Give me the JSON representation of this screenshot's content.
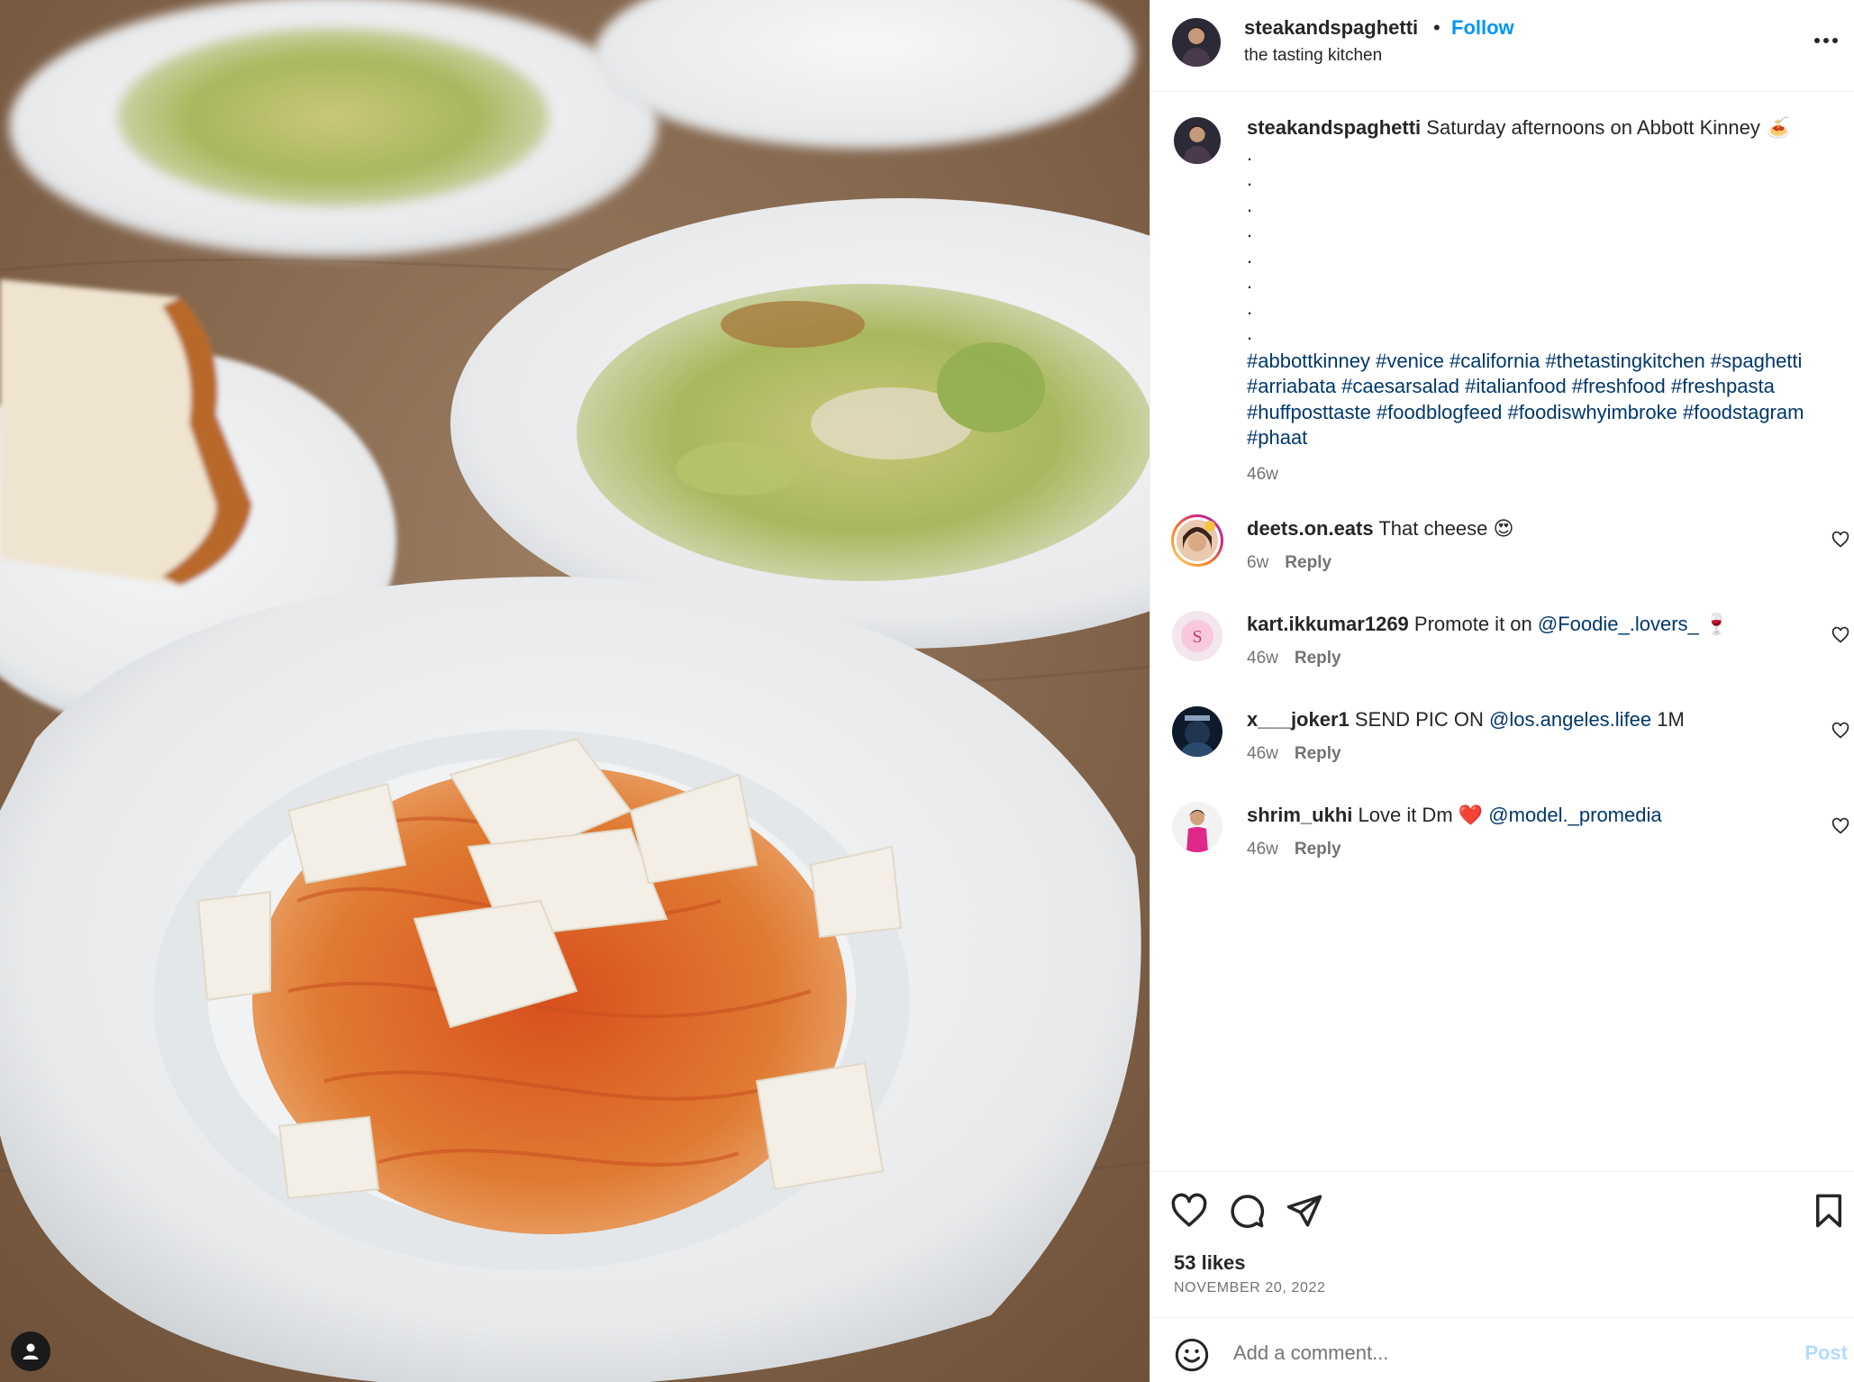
{
  "post": {
    "username": "steakandspaghetti",
    "follow_label": "Follow",
    "separator": "•",
    "location": "the tasting kitchen",
    "more_icon": "more-horizontal-icon"
  },
  "caption": {
    "username": "steakandspaghetti",
    "text": "Saturday afternoons on Abbott Kinney 🍝",
    "dots": [
      ".",
      ".",
      ".",
      ".",
      ".",
      ".",
      ".",
      "."
    ],
    "hashtags": "#abbottkinney #venice #california #thetastingkitchen #spaghetti #arriabata #caesarsalad #italianfood #freshfood #freshpasta #huffposttaste #foodblogfeed #foodiswhyimbroke #foodstagram #phaat",
    "time": "46w"
  },
  "comments": [
    {
      "username": "deets.on.eats",
      "text": "That cheese 😍",
      "mention": "",
      "suffix": "",
      "time": "6w",
      "reply": "Reply"
    },
    {
      "username": "kart.ikkumar1269",
      "text": "Promote it on",
      "mention": "@Foodie_.lovers_",
      "suffix": "🍷",
      "time": "46w",
      "reply": "Reply"
    },
    {
      "username": "x___joker1",
      "text": "SEND PIC ON",
      "mention": "@los.angeles.lifee",
      "suffix": "1M",
      "time": "46w",
      "reply": "Reply"
    },
    {
      "username": "shrim_ukhi",
      "text": "Love it Dm ❤️",
      "mention": "@model._promedia",
      "suffix": "",
      "time": "46w",
      "reply": "Reply"
    }
  ],
  "actions": {
    "likes": "53 likes",
    "date": "NOVEMBER 20, 2022",
    "icons": [
      "heart-icon",
      "comment-icon",
      "share-icon",
      "bookmark-icon"
    ]
  },
  "add_comment": {
    "placeholder": "Add a comment...",
    "post_label": "Post",
    "emoji_icon": "emoji-icon"
  },
  "colors": {
    "accent": "#0095f6",
    "link": "#00376b",
    "muted": "#737373",
    "post_disabled": "#b3dbff"
  }
}
